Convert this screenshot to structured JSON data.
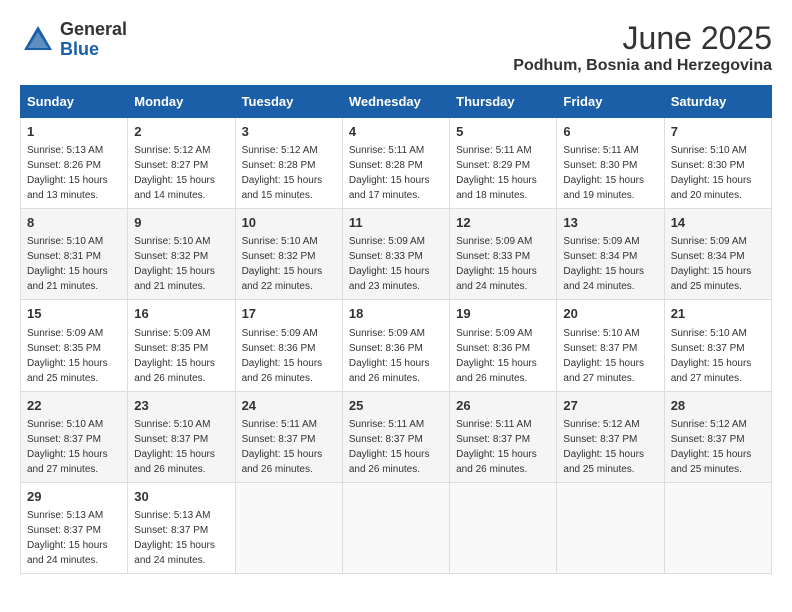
{
  "logo": {
    "general": "General",
    "blue": "Blue"
  },
  "title": "June 2025",
  "location": "Podhum, Bosnia and Herzegovina",
  "weekdays": [
    "Sunday",
    "Monday",
    "Tuesday",
    "Wednesday",
    "Thursday",
    "Friday",
    "Saturday"
  ],
  "weeks": [
    [
      {
        "day": "1",
        "sunrise": "5:13 AM",
        "sunset": "8:26 PM",
        "daylight": "15 hours and 13 minutes."
      },
      {
        "day": "2",
        "sunrise": "5:12 AM",
        "sunset": "8:27 PM",
        "daylight": "15 hours and 14 minutes."
      },
      {
        "day": "3",
        "sunrise": "5:12 AM",
        "sunset": "8:28 PM",
        "daylight": "15 hours and 15 minutes."
      },
      {
        "day": "4",
        "sunrise": "5:11 AM",
        "sunset": "8:28 PM",
        "daylight": "15 hours and 17 minutes."
      },
      {
        "day": "5",
        "sunrise": "5:11 AM",
        "sunset": "8:29 PM",
        "daylight": "15 hours and 18 minutes."
      },
      {
        "day": "6",
        "sunrise": "5:11 AM",
        "sunset": "8:30 PM",
        "daylight": "15 hours and 19 minutes."
      },
      {
        "day": "7",
        "sunrise": "5:10 AM",
        "sunset": "8:30 PM",
        "daylight": "15 hours and 20 minutes."
      }
    ],
    [
      {
        "day": "8",
        "sunrise": "5:10 AM",
        "sunset": "8:31 PM",
        "daylight": "15 hours and 21 minutes."
      },
      {
        "day": "9",
        "sunrise": "5:10 AM",
        "sunset": "8:32 PM",
        "daylight": "15 hours and 21 minutes."
      },
      {
        "day": "10",
        "sunrise": "5:10 AM",
        "sunset": "8:32 PM",
        "daylight": "15 hours and 22 minutes."
      },
      {
        "day": "11",
        "sunrise": "5:09 AM",
        "sunset": "8:33 PM",
        "daylight": "15 hours and 23 minutes."
      },
      {
        "day": "12",
        "sunrise": "5:09 AM",
        "sunset": "8:33 PM",
        "daylight": "15 hours and 24 minutes."
      },
      {
        "day": "13",
        "sunrise": "5:09 AM",
        "sunset": "8:34 PM",
        "daylight": "15 hours and 24 minutes."
      },
      {
        "day": "14",
        "sunrise": "5:09 AM",
        "sunset": "8:34 PM",
        "daylight": "15 hours and 25 minutes."
      }
    ],
    [
      {
        "day": "15",
        "sunrise": "5:09 AM",
        "sunset": "8:35 PM",
        "daylight": "15 hours and 25 minutes."
      },
      {
        "day": "16",
        "sunrise": "5:09 AM",
        "sunset": "8:35 PM",
        "daylight": "15 hours and 26 minutes."
      },
      {
        "day": "17",
        "sunrise": "5:09 AM",
        "sunset": "8:36 PM",
        "daylight": "15 hours and 26 minutes."
      },
      {
        "day": "18",
        "sunrise": "5:09 AM",
        "sunset": "8:36 PM",
        "daylight": "15 hours and 26 minutes."
      },
      {
        "day": "19",
        "sunrise": "5:09 AM",
        "sunset": "8:36 PM",
        "daylight": "15 hours and 26 minutes."
      },
      {
        "day": "20",
        "sunrise": "5:10 AM",
        "sunset": "8:37 PM",
        "daylight": "15 hours and 27 minutes."
      },
      {
        "day": "21",
        "sunrise": "5:10 AM",
        "sunset": "8:37 PM",
        "daylight": "15 hours and 27 minutes."
      }
    ],
    [
      {
        "day": "22",
        "sunrise": "5:10 AM",
        "sunset": "8:37 PM",
        "daylight": "15 hours and 27 minutes."
      },
      {
        "day": "23",
        "sunrise": "5:10 AM",
        "sunset": "8:37 PM",
        "daylight": "15 hours and 26 minutes."
      },
      {
        "day": "24",
        "sunrise": "5:11 AM",
        "sunset": "8:37 PM",
        "daylight": "15 hours and 26 minutes."
      },
      {
        "day": "25",
        "sunrise": "5:11 AM",
        "sunset": "8:37 PM",
        "daylight": "15 hours and 26 minutes."
      },
      {
        "day": "26",
        "sunrise": "5:11 AM",
        "sunset": "8:37 PM",
        "daylight": "15 hours and 26 minutes."
      },
      {
        "day": "27",
        "sunrise": "5:12 AM",
        "sunset": "8:37 PM",
        "daylight": "15 hours and 25 minutes."
      },
      {
        "day": "28",
        "sunrise": "5:12 AM",
        "sunset": "8:37 PM",
        "daylight": "15 hours and 25 minutes."
      }
    ],
    [
      {
        "day": "29",
        "sunrise": "5:13 AM",
        "sunset": "8:37 PM",
        "daylight": "15 hours and 24 minutes."
      },
      {
        "day": "30",
        "sunrise": "5:13 AM",
        "sunset": "8:37 PM",
        "daylight": "15 hours and 24 minutes."
      },
      null,
      null,
      null,
      null,
      null
    ]
  ],
  "labels": {
    "sunrise": "Sunrise:",
    "sunset": "Sunset:",
    "daylight": "Daylight:"
  }
}
